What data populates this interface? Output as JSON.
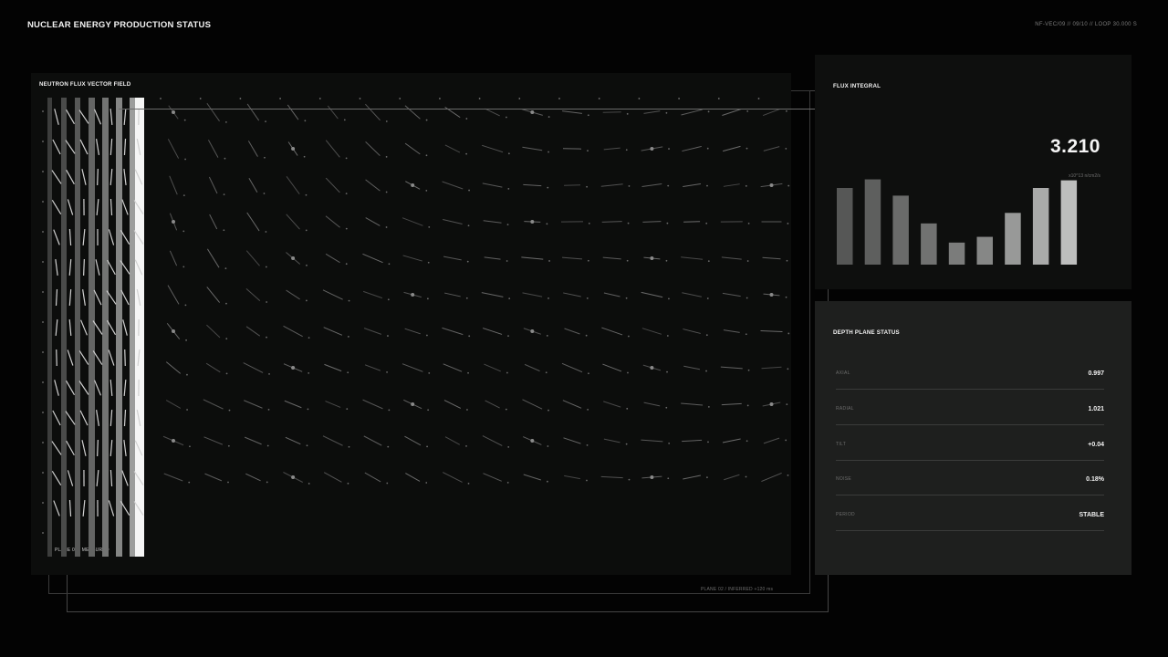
{
  "header": {
    "title": "NUCLEAR ENERGY PRODUCTION STATUS",
    "meta": "NF-VEC/09 // 09/10 // LOOP 30.000 S"
  },
  "vector_field": {
    "title": "NEUTRON FLUX VECTOR FIELD",
    "plane_measured": "PLANE 01 / MEASURED",
    "plane_inferred": "PLANE 02 / INFERRED +120 ms"
  },
  "flux": {
    "title": "FLUX INTEGRAL",
    "value": "3.210",
    "unit": "x10^13 n/cm2/s",
    "bars": [
      0.8,
      0.89,
      0.72,
      0.43,
      0.23,
      0.29,
      0.54,
      0.8,
      0.88
    ],
    "bar_colors": [
      "#565756",
      "#5e5f5e",
      "#6a6b6a",
      "#717271",
      "#7b7c7b",
      "#868786",
      "#989998",
      "#a9aaa9",
      "#bdbebd"
    ]
  },
  "depth": {
    "title": "DEPTH PLANE STATUS",
    "rows": [
      {
        "label": "AXIAL",
        "value": "0.997"
      },
      {
        "label": "RADIAL",
        "value": "1.021"
      },
      {
        "label": "TILT",
        "value": "+0.04"
      },
      {
        "label": "NOISE",
        "value": "0.18%"
      },
      {
        "label": "PERIOD",
        "value": "STABLE"
      }
    ]
  },
  "colors": {
    "background": "#030303",
    "panel": "#0c0d0c",
    "accent": "#f4f4f4"
  }
}
